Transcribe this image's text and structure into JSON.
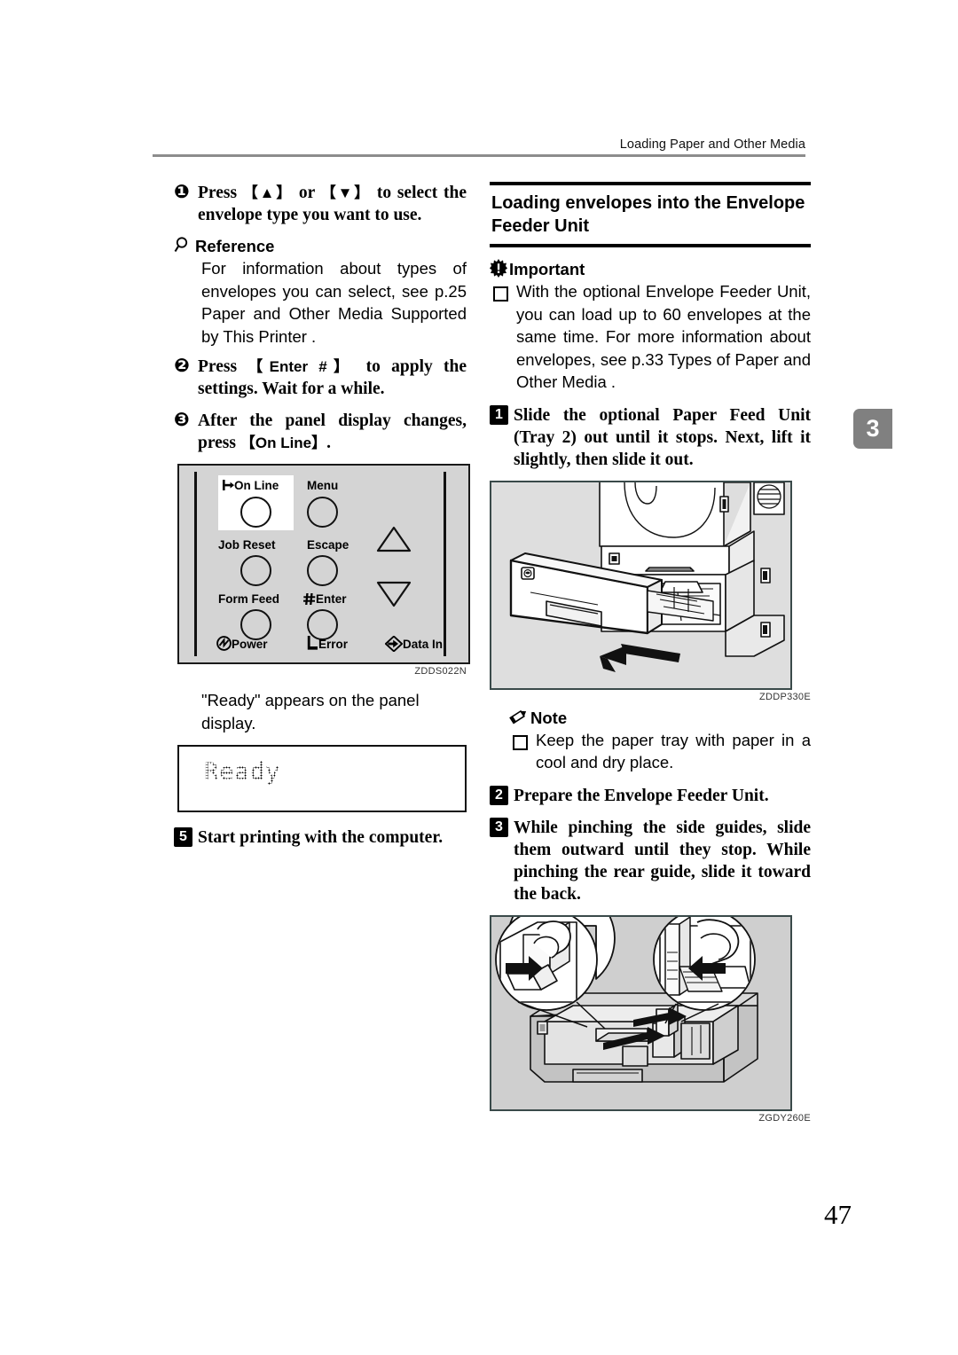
{
  "header": {
    "running_head": "Loading Paper and Other Media"
  },
  "chapter_tab": {
    "number": "3"
  },
  "page_number": "47",
  "left_column": {
    "step5": {
      "marker": "❶",
      "text_parts": [
        "Press ",
        "【▲】",
        " or ",
        "【▼】",
        " to select the envelope type you want to use."
      ]
    },
    "reference": {
      "icon": "magnifier-icon",
      "label": "Reference",
      "body": "For information about types of envelopes you can select, see p.25  Paper and Other Media Supported by This Printer  ."
    },
    "step6": {
      "marker": "❷",
      "pre": "Press ",
      "key": "【Enter #】",
      "post": " to apply the settings. Wait for a while."
    },
    "step7": {
      "marker": "❸",
      "pre": "After the panel display changes, press ",
      "key": "【On Line】",
      "post": "."
    },
    "control_panel": {
      "caption": "ZDDS022N",
      "buttons": [
        {
          "label": "On Line",
          "icon": "online-arrow-icon"
        },
        {
          "label": "Menu",
          "icon": ""
        },
        {
          "label": "Job Reset",
          "icon": ""
        },
        {
          "label": "Escape",
          "icon": ""
        },
        {
          "label": "Form Feed",
          "icon": ""
        },
        {
          "label": "Enter",
          "icon": "hash-icon"
        }
      ],
      "indicators": [
        {
          "label": "Power",
          "icon": "power-icon"
        },
        {
          "label": "Error",
          "icon": "error-icon"
        },
        {
          "label": "Data In",
          "icon": "data-in-icon"
        }
      ],
      "arrow_up": "△",
      "arrow_down": "▽"
    },
    "ready_note": "\"Ready\" appears on the panel display.",
    "lcd": {
      "text": "Ready"
    },
    "step_start": {
      "marker": "5",
      "text": "Start printing with the computer."
    }
  },
  "right_column": {
    "section": {
      "title": "Loading envelopes into the Envelope Feeder Unit"
    },
    "important": {
      "icon": "important-icon",
      "label": "Important",
      "bullets": [
        "With the optional Envelope Feeder Unit, you can load up to 60 envelopes at the same time. For more information about envelopes, see p.33  Types of Paper and Other Media  ."
      ]
    },
    "step1": {
      "marker": "1",
      "text": "Slide the optional Paper Feed Unit (Tray 2) out until it stops. Next, lift it slightly, then slide it out."
    },
    "figure1": {
      "caption": "ZDDP330E",
      "alt": "printer-tray-pullout-illustration"
    },
    "note": {
      "icon": "note-pencil-icon",
      "label": "Note",
      "bullets": [
        "Keep the paper tray with paper in a cool and dry place."
      ]
    },
    "step2": {
      "marker": "2",
      "text": "Prepare the Envelope Feeder Unit."
    },
    "step3": {
      "marker": "3",
      "text": "While pinching the side guides, slide them outward until they stop. While pinching the rear guide, slide it toward the back."
    },
    "figure2": {
      "caption": "ZGDY260E",
      "alt": "paper-tray-guides-illustration"
    }
  },
  "colors": {
    "rule_gray": "#8d8d8d",
    "tab_gray": "#808080",
    "illus_bg": "#dedede",
    "illus_border": "#3a4a4a",
    "lcd_text": "#555555"
  }
}
